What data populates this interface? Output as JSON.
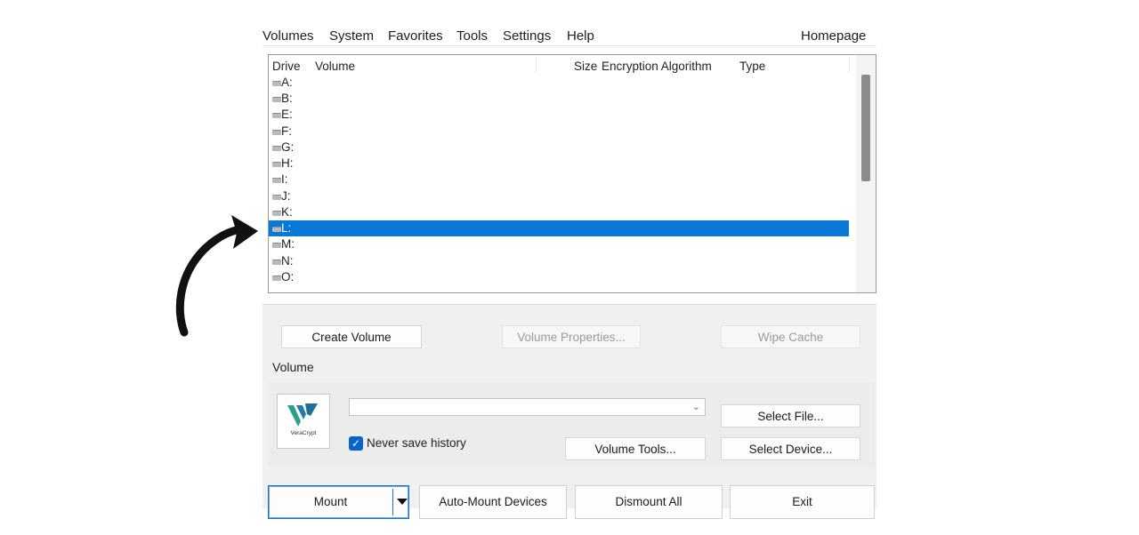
{
  "menu": {
    "items": [
      "Volumes",
      "System",
      "Favorites",
      "Tools",
      "Settings",
      "Help"
    ],
    "homepage": "Homepage"
  },
  "drive_list": {
    "columns": [
      "Drive",
      "Volume",
      "Size",
      "Encryption Algorithm",
      "Type"
    ],
    "drives": [
      "A:",
      "B:",
      "E:",
      "F:",
      "G:",
      "H:",
      "I:",
      "J:",
      "K:",
      "L:",
      "M:",
      "N:",
      "O:"
    ],
    "selected_drive": "L:"
  },
  "actions": {
    "create_volume": "Create Volume",
    "volume_properties": "Volume Properties...",
    "wipe_cache": "Wipe Cache"
  },
  "volume_group": {
    "label": "Volume",
    "logo_text": "VeraCrypt",
    "path_value": "",
    "never_save_history": "Never save history",
    "never_save_history_checked": true,
    "select_file": "Select File...",
    "volume_tools": "Volume Tools...",
    "select_device": "Select Device..."
  },
  "bottom": {
    "mount": "Mount",
    "auto_mount": "Auto-Mount Devices",
    "dismount_all": "Dismount All",
    "exit": "Exit"
  },
  "colors": {
    "selection": "#0a78d7",
    "panel_bg": "#f0f0f0",
    "accent": "#0a64c8"
  },
  "icons": [
    "drive-icon",
    "veracrypt-logo",
    "dropdown-arrow-icon",
    "checkmark-icon",
    "curved-arrow-annotation"
  ]
}
